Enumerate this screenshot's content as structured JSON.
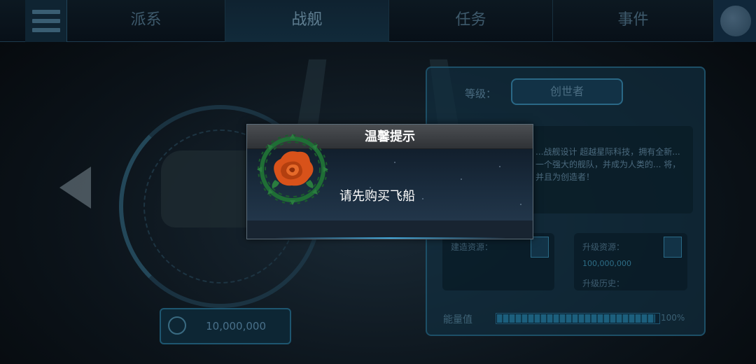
{
  "nav": {
    "tabs": [
      {
        "label": "派系",
        "active": false
      },
      {
        "label": "战舰",
        "active": true
      },
      {
        "label": "任务",
        "active": false
      },
      {
        "label": "事件",
        "active": false
      }
    ],
    "menu_icon": "hamburger-menu-icon",
    "globe_icon": "globe-icon"
  },
  "background": {
    "rank_label": "等级：",
    "rank_value": "创世者",
    "description": "...战舰设计 超越星际科技，拥有全新... 一个强大的舰队，并成为人类的... 将，并且为创造者！",
    "stat1_label": "建造资源：",
    "stat2_label": "升级资源：",
    "stat2_value": "100,000,000",
    "stat3_label": "升级历史：",
    "power_label": "能量值",
    "power_percent": "100%",
    "power_fraction": 0.96,
    "coins": "10,000,000"
  },
  "dialog": {
    "title": "温馨提示",
    "message": "请先购买飞船",
    "emblem_icon": "rose-wreath-emblem-icon",
    "colors": {
      "rose": "#e25a1c",
      "wreath": "#1f6e35"
    }
  }
}
